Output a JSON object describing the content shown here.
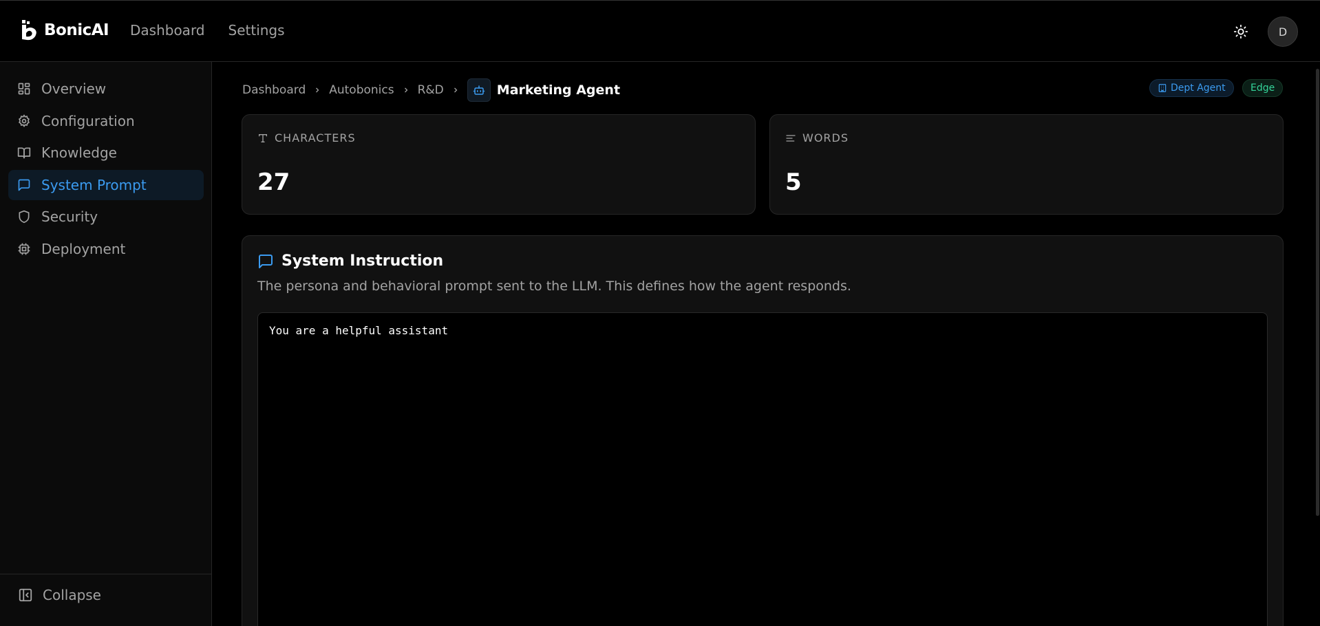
{
  "app": {
    "name": "BonicAI"
  },
  "topnav": {
    "items": [
      "Dashboard",
      "Settings"
    ]
  },
  "user": {
    "avatar_initial": "D"
  },
  "sidebar": {
    "items": [
      {
        "label": "Overview",
        "icon": "grid-icon"
      },
      {
        "label": "Configuration",
        "icon": "gear-icon"
      },
      {
        "label": "Knowledge",
        "icon": "book-icon"
      },
      {
        "label": "System Prompt",
        "icon": "message-icon",
        "active": true
      },
      {
        "label": "Security",
        "icon": "shield-icon"
      },
      {
        "label": "Deployment",
        "icon": "chip-icon"
      }
    ],
    "collapse_label": "Collapse"
  },
  "breadcrumb": {
    "items": [
      "Dashboard",
      "Autobonics",
      "R&D"
    ],
    "current": "Marketing Agent"
  },
  "badges": {
    "dept": "Dept Agent",
    "edge": "Edge"
  },
  "stats": {
    "characters": {
      "label": "CHARACTERS",
      "value": "27"
    },
    "words": {
      "label": "WORDS",
      "value": "5"
    }
  },
  "instruction": {
    "title": "System Instruction",
    "description": "The persona and behavioral prompt sent to the LLM. This defines how the agent responds.",
    "prompt": "You are a helpful assistant"
  },
  "colors": {
    "accent": "#3b9bf0",
    "edge": "#34d399",
    "background": "#000000",
    "card": "#111111"
  }
}
